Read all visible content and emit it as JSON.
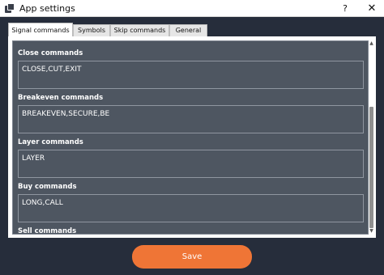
{
  "window": {
    "title": "App settings",
    "help_label": "?",
    "close_label": "✕",
    "icon": "app-icon"
  },
  "tabs": [
    {
      "label": "Signal commands",
      "active": true
    },
    {
      "label": "Symbols",
      "active": false
    },
    {
      "label": "Skip commands",
      "active": false
    },
    {
      "label": "General",
      "active": false
    }
  ],
  "sections": [
    {
      "label": "Close commands",
      "value": "CLOSE,CUT,EXIT"
    },
    {
      "label": "Breakeven commands",
      "value": "BREAKEVEN,SECURE,BE"
    },
    {
      "label": "Layer commands",
      "value": "LAYER"
    },
    {
      "label": "Buy commands",
      "value": "LONG,CALL"
    },
    {
      "label": "Sell commands",
      "value": ""
    }
  ],
  "scrollbar": {
    "up_arrow": "▲",
    "down_arrow": "▼"
  },
  "save_button": {
    "label": "Save"
  },
  "colors": {
    "background": "#262d3b",
    "panel": "#4e5661",
    "accent": "#ef7536"
  }
}
